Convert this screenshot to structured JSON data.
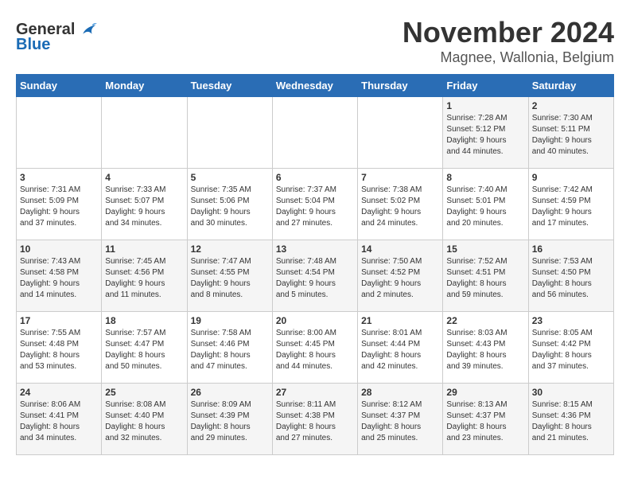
{
  "logo": {
    "general": "General",
    "blue": "Blue"
  },
  "header": {
    "month": "November 2024",
    "location": "Magnee, Wallonia, Belgium"
  },
  "weekdays": [
    "Sunday",
    "Monday",
    "Tuesday",
    "Wednesday",
    "Thursday",
    "Friday",
    "Saturday"
  ],
  "weeks": [
    [
      {
        "day": "",
        "info": ""
      },
      {
        "day": "",
        "info": ""
      },
      {
        "day": "",
        "info": ""
      },
      {
        "day": "",
        "info": ""
      },
      {
        "day": "",
        "info": ""
      },
      {
        "day": "1",
        "info": "Sunrise: 7:28 AM\nSunset: 5:12 PM\nDaylight: 9 hours\nand 44 minutes."
      },
      {
        "day": "2",
        "info": "Sunrise: 7:30 AM\nSunset: 5:11 PM\nDaylight: 9 hours\nand 40 minutes."
      }
    ],
    [
      {
        "day": "3",
        "info": "Sunrise: 7:31 AM\nSunset: 5:09 PM\nDaylight: 9 hours\nand 37 minutes."
      },
      {
        "day": "4",
        "info": "Sunrise: 7:33 AM\nSunset: 5:07 PM\nDaylight: 9 hours\nand 34 minutes."
      },
      {
        "day": "5",
        "info": "Sunrise: 7:35 AM\nSunset: 5:06 PM\nDaylight: 9 hours\nand 30 minutes."
      },
      {
        "day": "6",
        "info": "Sunrise: 7:37 AM\nSunset: 5:04 PM\nDaylight: 9 hours\nand 27 minutes."
      },
      {
        "day": "7",
        "info": "Sunrise: 7:38 AM\nSunset: 5:02 PM\nDaylight: 9 hours\nand 24 minutes."
      },
      {
        "day": "8",
        "info": "Sunrise: 7:40 AM\nSunset: 5:01 PM\nDaylight: 9 hours\nand 20 minutes."
      },
      {
        "day": "9",
        "info": "Sunrise: 7:42 AM\nSunset: 4:59 PM\nDaylight: 9 hours\nand 17 minutes."
      }
    ],
    [
      {
        "day": "10",
        "info": "Sunrise: 7:43 AM\nSunset: 4:58 PM\nDaylight: 9 hours\nand 14 minutes."
      },
      {
        "day": "11",
        "info": "Sunrise: 7:45 AM\nSunset: 4:56 PM\nDaylight: 9 hours\nand 11 minutes."
      },
      {
        "day": "12",
        "info": "Sunrise: 7:47 AM\nSunset: 4:55 PM\nDaylight: 9 hours\nand 8 minutes."
      },
      {
        "day": "13",
        "info": "Sunrise: 7:48 AM\nSunset: 4:54 PM\nDaylight: 9 hours\nand 5 minutes."
      },
      {
        "day": "14",
        "info": "Sunrise: 7:50 AM\nSunset: 4:52 PM\nDaylight: 9 hours\nand 2 minutes."
      },
      {
        "day": "15",
        "info": "Sunrise: 7:52 AM\nSunset: 4:51 PM\nDaylight: 8 hours\nand 59 minutes."
      },
      {
        "day": "16",
        "info": "Sunrise: 7:53 AM\nSunset: 4:50 PM\nDaylight: 8 hours\nand 56 minutes."
      }
    ],
    [
      {
        "day": "17",
        "info": "Sunrise: 7:55 AM\nSunset: 4:48 PM\nDaylight: 8 hours\nand 53 minutes."
      },
      {
        "day": "18",
        "info": "Sunrise: 7:57 AM\nSunset: 4:47 PM\nDaylight: 8 hours\nand 50 minutes."
      },
      {
        "day": "19",
        "info": "Sunrise: 7:58 AM\nSunset: 4:46 PM\nDaylight: 8 hours\nand 47 minutes."
      },
      {
        "day": "20",
        "info": "Sunrise: 8:00 AM\nSunset: 4:45 PM\nDaylight: 8 hours\nand 44 minutes."
      },
      {
        "day": "21",
        "info": "Sunrise: 8:01 AM\nSunset: 4:44 PM\nDaylight: 8 hours\nand 42 minutes."
      },
      {
        "day": "22",
        "info": "Sunrise: 8:03 AM\nSunset: 4:43 PM\nDaylight: 8 hours\nand 39 minutes."
      },
      {
        "day": "23",
        "info": "Sunrise: 8:05 AM\nSunset: 4:42 PM\nDaylight: 8 hours\nand 37 minutes."
      }
    ],
    [
      {
        "day": "24",
        "info": "Sunrise: 8:06 AM\nSunset: 4:41 PM\nDaylight: 8 hours\nand 34 minutes."
      },
      {
        "day": "25",
        "info": "Sunrise: 8:08 AM\nSunset: 4:40 PM\nDaylight: 8 hours\nand 32 minutes."
      },
      {
        "day": "26",
        "info": "Sunrise: 8:09 AM\nSunset: 4:39 PM\nDaylight: 8 hours\nand 29 minutes."
      },
      {
        "day": "27",
        "info": "Sunrise: 8:11 AM\nSunset: 4:38 PM\nDaylight: 8 hours\nand 27 minutes."
      },
      {
        "day": "28",
        "info": "Sunrise: 8:12 AM\nSunset: 4:37 PM\nDaylight: 8 hours\nand 25 minutes."
      },
      {
        "day": "29",
        "info": "Sunrise: 8:13 AM\nSunset: 4:37 PM\nDaylight: 8 hours\nand 23 minutes."
      },
      {
        "day": "30",
        "info": "Sunrise: 8:15 AM\nSunset: 4:36 PM\nDaylight: 8 hours\nand 21 minutes."
      }
    ]
  ]
}
